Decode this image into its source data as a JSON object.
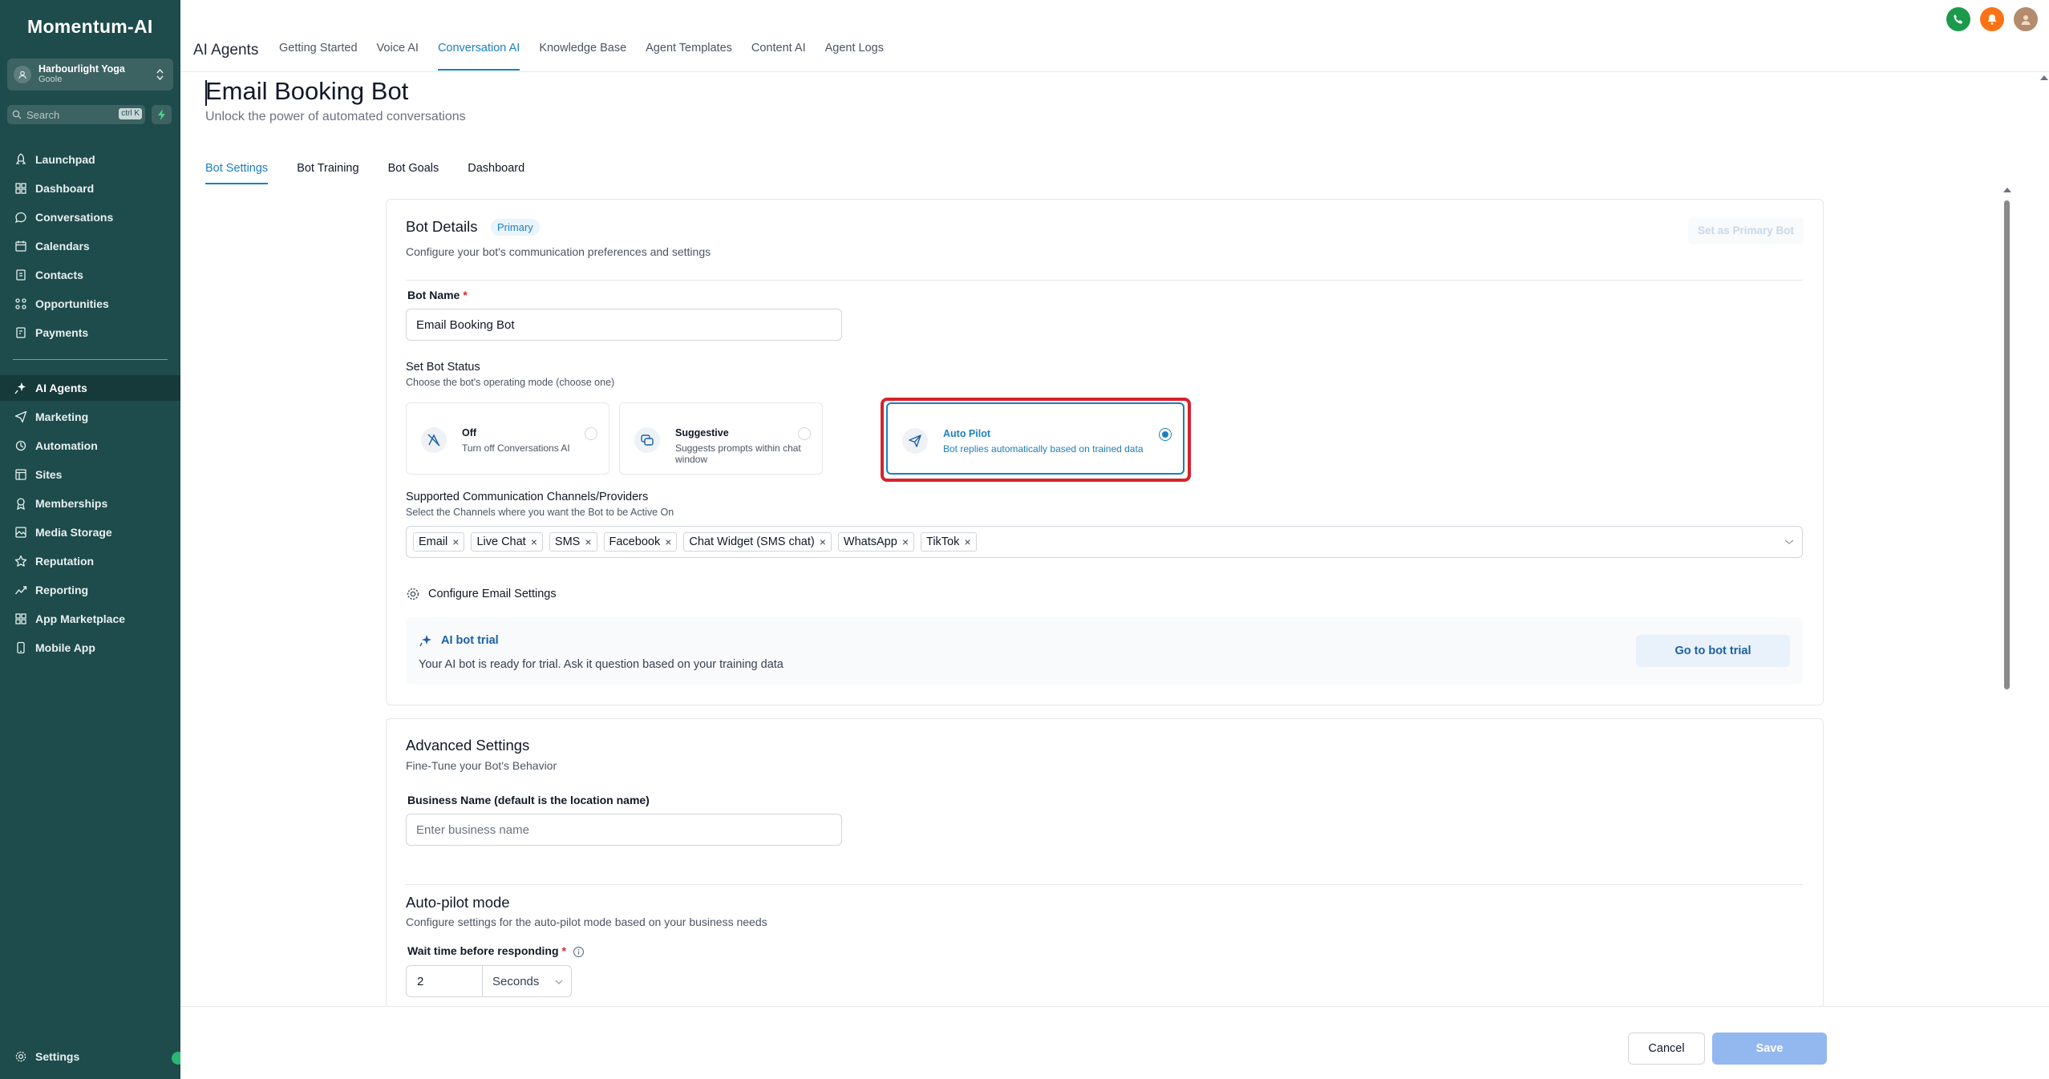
{
  "app": {
    "logo": "Momentum-AI",
    "location": {
      "name": "Harbourlight Yoga",
      "sub": "Goole"
    },
    "search": {
      "placeholder": "Search",
      "shortcut": "ctrl K"
    }
  },
  "sidebar": {
    "items": [
      {
        "label": "Launchpad",
        "icon": "rocket-icon"
      },
      {
        "label": "Dashboard",
        "icon": "grid-icon"
      },
      {
        "label": "Conversations",
        "icon": "chat-icon"
      },
      {
        "label": "Calendars",
        "icon": "calendar-icon"
      },
      {
        "label": "Contacts",
        "icon": "contacts-icon"
      },
      {
        "label": "Opportunities",
        "icon": "opportunities-icon"
      },
      {
        "label": "Payments",
        "icon": "payments-icon"
      },
      {
        "label": "AI Agents",
        "icon": "sparkle-icon",
        "active": true
      },
      {
        "label": "Marketing",
        "icon": "send-icon"
      },
      {
        "label": "Automation",
        "icon": "automation-icon"
      },
      {
        "label": "Sites",
        "icon": "sites-icon"
      },
      {
        "label": "Memberships",
        "icon": "memberships-icon"
      },
      {
        "label": "Media Storage",
        "icon": "media-icon"
      },
      {
        "label": "Reputation",
        "icon": "star-icon"
      },
      {
        "label": "Reporting",
        "icon": "chart-icon"
      },
      {
        "label": "App Marketplace",
        "icon": "apps-icon"
      },
      {
        "label": "Mobile App",
        "icon": "mobile-icon"
      }
    ],
    "settings": "Settings"
  },
  "header": {
    "brand": "AI Agents",
    "tabs": [
      {
        "label": "Getting Started"
      },
      {
        "label": "Voice AI"
      },
      {
        "label": "Conversation AI",
        "active": true
      },
      {
        "label": "Knowledge Base"
      },
      {
        "label": "Agent Templates"
      },
      {
        "label": "Content AI"
      },
      {
        "label": "Agent Logs"
      }
    ]
  },
  "page": {
    "title": "Email Booking Bot",
    "subtitle": "Unlock the power of automated conversations",
    "subtabs": [
      {
        "label": "Bot Settings",
        "active": true
      },
      {
        "label": "Bot Training"
      },
      {
        "label": "Bot Goals"
      },
      {
        "label": "Dashboard"
      }
    ]
  },
  "bot_details": {
    "title": "Bot Details",
    "badge": "Primary",
    "description": "Configure your bot's communication preferences and settings",
    "primary_button": "Set as Primary Bot",
    "name_label": "Bot Name",
    "name_value": "Email Booking Bot",
    "status_label": "Set Bot Status",
    "status_hint": "Choose the bot's operating mode (choose one)",
    "statuses": [
      {
        "title": "Off",
        "desc": "Turn off Conversations AI",
        "icon": "bot-off-icon"
      },
      {
        "title": "Suggestive",
        "desc": "Suggests prompts within chat window",
        "icon": "chat-suggest-icon"
      },
      {
        "title": "Auto Pilot",
        "desc": "Bot replies automatically based on trained data",
        "icon": "paper-plane-icon",
        "selected": true
      }
    ],
    "channels_label": "Supported Communication Channels/Providers",
    "channels_hint": "Select the Channels where you want the Bot to be Active On",
    "channels": [
      "Email",
      "Live Chat",
      "SMS",
      "Facebook",
      "Chat Widget (SMS chat)",
      "WhatsApp",
      "TikTok"
    ],
    "configure_email": "Configure Email Settings",
    "trial": {
      "title": "AI bot trial",
      "desc": "Your AI bot is ready for trial. Ask it question based on your training data",
      "button": "Go to bot trial"
    }
  },
  "advanced": {
    "title": "Advanced Settings",
    "subtitle": "Fine-Tune your Bot's Behavior",
    "business_label": "Business Name (default is the location name)",
    "business_placeholder": "Enter business name",
    "autopilot_title": "Auto-pilot mode",
    "autopilot_desc": "Configure settings for the auto-pilot mode based on your business needs",
    "wait_label": "Wait time before responding",
    "wait_value": "2",
    "wait_unit": "Seconds"
  },
  "footer": {
    "cancel": "Cancel",
    "save": "Save"
  },
  "colors": {
    "sidebar": "#1e4b4b",
    "accent": "#1c7fbf",
    "highlight": "#d5232c",
    "save": "#93b7ef"
  }
}
